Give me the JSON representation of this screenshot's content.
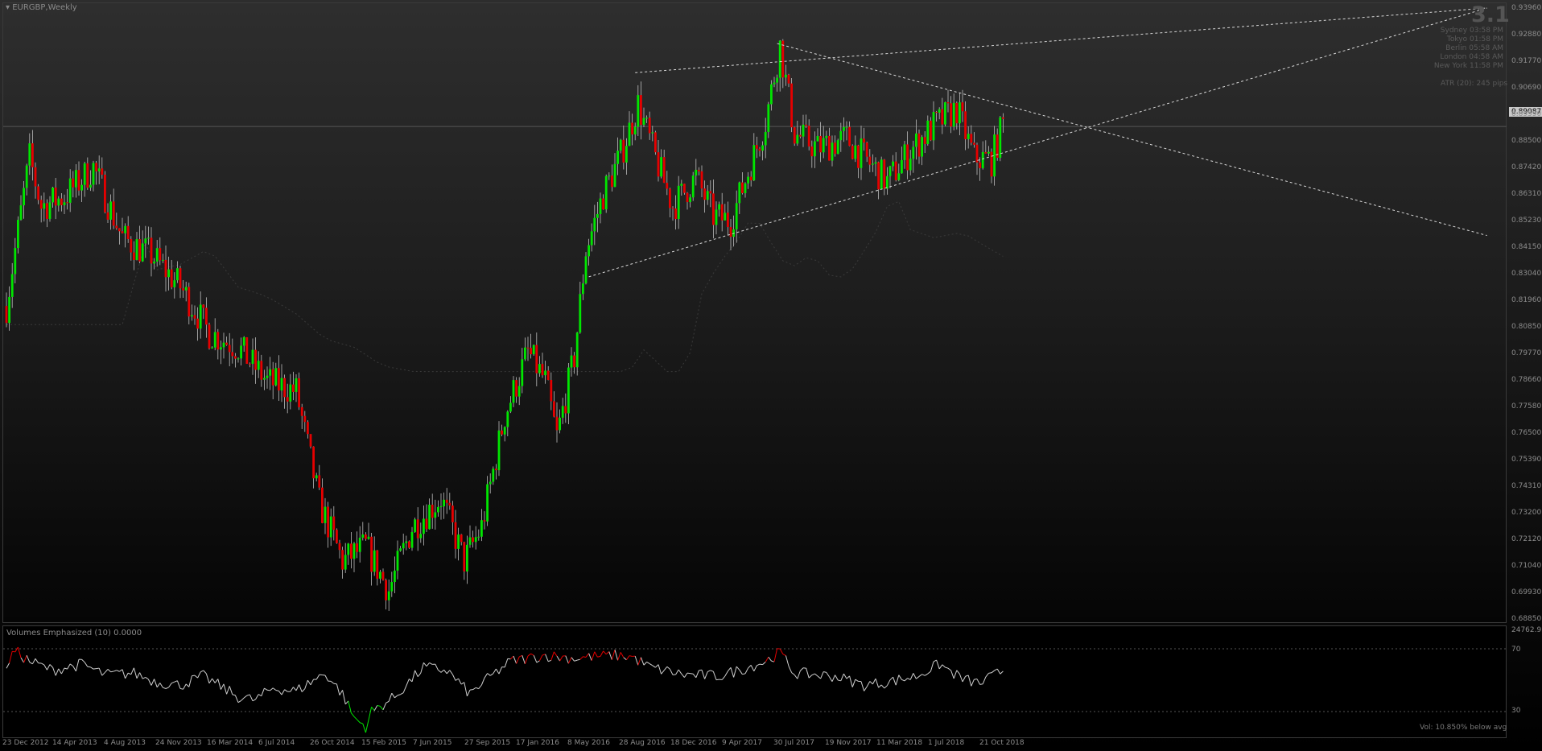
{
  "window": {
    "title": "EURGBP,Weekly"
  },
  "indicator": {
    "title": "Volumes Emphasized  (10)  0.0000",
    "max_label": "24762.93",
    "level_70": "70",
    "level_30": "30",
    "note": "Vol:  10.850% below avg"
  },
  "info": {
    "version": "3.1",
    "sessions": [
      {
        "city": "Sydney",
        "time": "03:58 PM"
      },
      {
        "city": "Tokyo",
        "time": "01:58 PM"
      },
      {
        "city": "Berlin",
        "time": "05:58 AM"
      },
      {
        "city": "London",
        "time": "04:58 AM"
      },
      {
        "city": "New York",
        "time": "11:58 PM"
      }
    ],
    "atr": "ATR (20): 245 pips"
  },
  "price_axis": {
    "current": "0.89087",
    "labels": [
      "0.93960",
      "0.92880",
      "0.91770",
      "0.90690",
      "0.89590",
      "0.88500",
      "0.87420",
      "0.86310",
      "0.85230",
      "0.84150",
      "0.83040",
      "0.81960",
      "0.80850",
      "0.79770",
      "0.78660",
      "0.77580",
      "0.76500",
      "0.75390",
      "0.74310",
      "0.73200",
      "0.72120",
      "0.71040",
      "0.69930",
      "0.68850"
    ]
  },
  "time_axis": [
    "23 Dec 2012",
    "14 Apr 2013",
    "4 Aug 2013",
    "24 Nov 2013",
    "16 Mar 2014",
    "6 Jul 2014",
    "26 Oct 2014",
    "15 Feb 2015",
    "7 Jun 2015",
    "27 Sep 2015",
    "17 Jan 2016",
    "8 May 2016",
    "28 Aug 2016",
    "18 Dec 2016",
    "9 Apr 2017",
    "30 Jul 2017",
    "19 Nov 2017",
    "11 Mar 2018",
    "1 Jul 2018",
    "21 Oct 2018"
  ],
  "colors": {
    "bull": "#00e600",
    "bear": "#e60000",
    "wick": "#bdbdbd",
    "trend": "#d8d8d8"
  },
  "chart_data": {
    "type": "candlestick",
    "symbol": "EURGBP",
    "timeframe": "Weekly",
    "ylim": [
      0.6885,
      0.9396
    ],
    "anchors": [
      [
        0,
        0.817
      ],
      [
        4,
        0.848
      ],
      [
        8,
        0.878
      ],
      [
        12,
        0.858
      ],
      [
        20,
        0.862
      ],
      [
        30,
        0.874
      ],
      [
        40,
        0.845
      ],
      [
        50,
        0.838
      ],
      [
        60,
        0.825
      ],
      [
        70,
        0.806
      ],
      [
        80,
        0.8
      ],
      [
        90,
        0.786
      ],
      [
        100,
        0.782
      ],
      [
        108,
        0.736
      ],
      [
        116,
        0.712
      ],
      [
        124,
        0.718
      ],
      [
        132,
        0.7
      ],
      [
        140,
        0.726
      ],
      [
        150,
        0.738
      ],
      [
        158,
        0.712
      ],
      [
        164,
        0.726
      ],
      [
        172,
        0.772
      ],
      [
        180,
        0.798
      ],
      [
        186,
        0.786
      ],
      [
        190,
        0.763
      ],
      [
        196,
        0.796
      ],
      [
        200,
        0.84
      ],
      [
        206,
        0.863
      ],
      [
        212,
        0.879
      ],
      [
        218,
        0.9
      ],
      [
        224,
        0.878
      ],
      [
        230,
        0.858
      ],
      [
        238,
        0.87
      ],
      [
        244,
        0.854
      ],
      [
        250,
        0.852
      ],
      [
        256,
        0.872
      ],
      [
        262,
        0.893
      ],
      [
        267,
        0.924
      ],
      [
        272,
        0.888
      ],
      [
        280,
        0.882
      ],
      [
        290,
        0.886
      ],
      [
        296,
        0.878
      ],
      [
        304,
        0.868
      ],
      [
        312,
        0.881
      ],
      [
        320,
        0.891
      ],
      [
        328,
        0.898
      ],
      [
        334,
        0.878
      ],
      [
        340,
        0.877
      ],
      [
        344,
        0.892
      ]
    ],
    "indicator_anchors": [
      [
        0,
        62
      ],
      [
        3,
        71
      ],
      [
        8,
        64
      ],
      [
        16,
        58
      ],
      [
        26,
        62
      ],
      [
        34,
        55
      ],
      [
        44,
        56
      ],
      [
        52,
        50
      ],
      [
        60,
        48
      ],
      [
        68,
        54
      ],
      [
        80,
        40
      ],
      [
        86,
        38
      ],
      [
        92,
        46
      ],
      [
        100,
        44
      ],
      [
        110,
        56
      ],
      [
        116,
        42
      ],
      [
        120,
        26
      ],
      [
        124,
        20
      ],
      [
        126,
        30
      ],
      [
        134,
        40
      ],
      [
        144,
        60
      ],
      [
        152,
        58
      ],
      [
        160,
        42
      ],
      [
        166,
        52
      ],
      [
        174,
        64
      ],
      [
        180,
        66
      ],
      [
        186,
        68
      ],
      [
        196,
        66
      ],
      [
        202,
        67
      ],
      [
        210,
        68
      ],
      [
        216,
        67
      ],
      [
        222,
        60
      ],
      [
        234,
        55
      ],
      [
        246,
        54
      ],
      [
        256,
        60
      ],
      [
        262,
        64
      ],
      [
        267,
        70
      ],
      [
        272,
        56
      ],
      [
        286,
        54
      ],
      [
        296,
        48
      ],
      [
        304,
        50
      ],
      [
        314,
        54
      ],
      [
        322,
        62
      ],
      [
        330,
        52
      ],
      [
        336,
        49
      ],
      [
        344,
        58
      ]
    ],
    "trendlines": [
      {
        "from": [
          201,
          0.829
        ],
        "to": [
          511,
          0.9396
        ]
      },
      {
        "from": [
          217,
          0.913
        ],
        "to": [
          511,
          0.9396
        ]
      },
      {
        "from": [
          266,
          0.925
        ],
        "to": [
          511,
          0.846
        ]
      }
    ]
  }
}
